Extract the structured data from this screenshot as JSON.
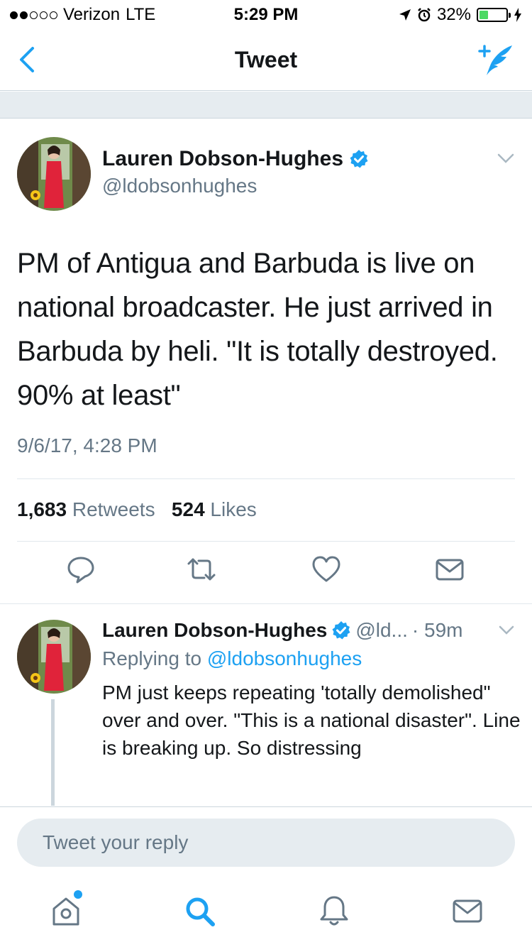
{
  "status_bar": {
    "carrier": "Verizon",
    "network": "LTE",
    "time": "5:29 PM",
    "battery": "32%",
    "battery_level": 0.32,
    "signal_bars": 2
  },
  "nav": {
    "title": "Tweet"
  },
  "main_tweet": {
    "author_name": "Lauren Dobson-Hughes",
    "author_handle": "@ldobsonhughes",
    "text": "PM of Antigua and Barbuda is live on national broadcaster. He just arrived in Barbuda by heli. \"It is totally destroyed. 90% at least\"",
    "date": "9/6/17, 4:28 PM",
    "retweets_count": "1,683",
    "retweets_label": "Retweets",
    "likes_count": "524",
    "likes_label": "Likes"
  },
  "reply_tweet": {
    "author_name": "Lauren Dobson-Hughes",
    "handle_truncated": "@ld...",
    "time": "· 59m",
    "replying_prefix": "Replying to",
    "replying_handle": "@ldobsonhughes",
    "text": "PM just keeps repeating 'totally demolished\" over and over. \"This is a national disaster\". Line is breaking up. So distressing"
  },
  "composer": {
    "placeholder": "Tweet your reply"
  },
  "colors": {
    "accent": "#1da1f2",
    "secondary_text": "#657786",
    "divider": "#e1e8ed",
    "band": "#e6ecf0"
  },
  "icons": {
    "nav": [
      "back-chevron-icon",
      "compose-tweet-icon"
    ],
    "actions": [
      "reply-icon",
      "retweet-icon",
      "like-icon",
      "direct-message-icon"
    ],
    "tabs": [
      "home-icon",
      "search-icon",
      "notifications-icon",
      "messages-icon"
    ]
  }
}
